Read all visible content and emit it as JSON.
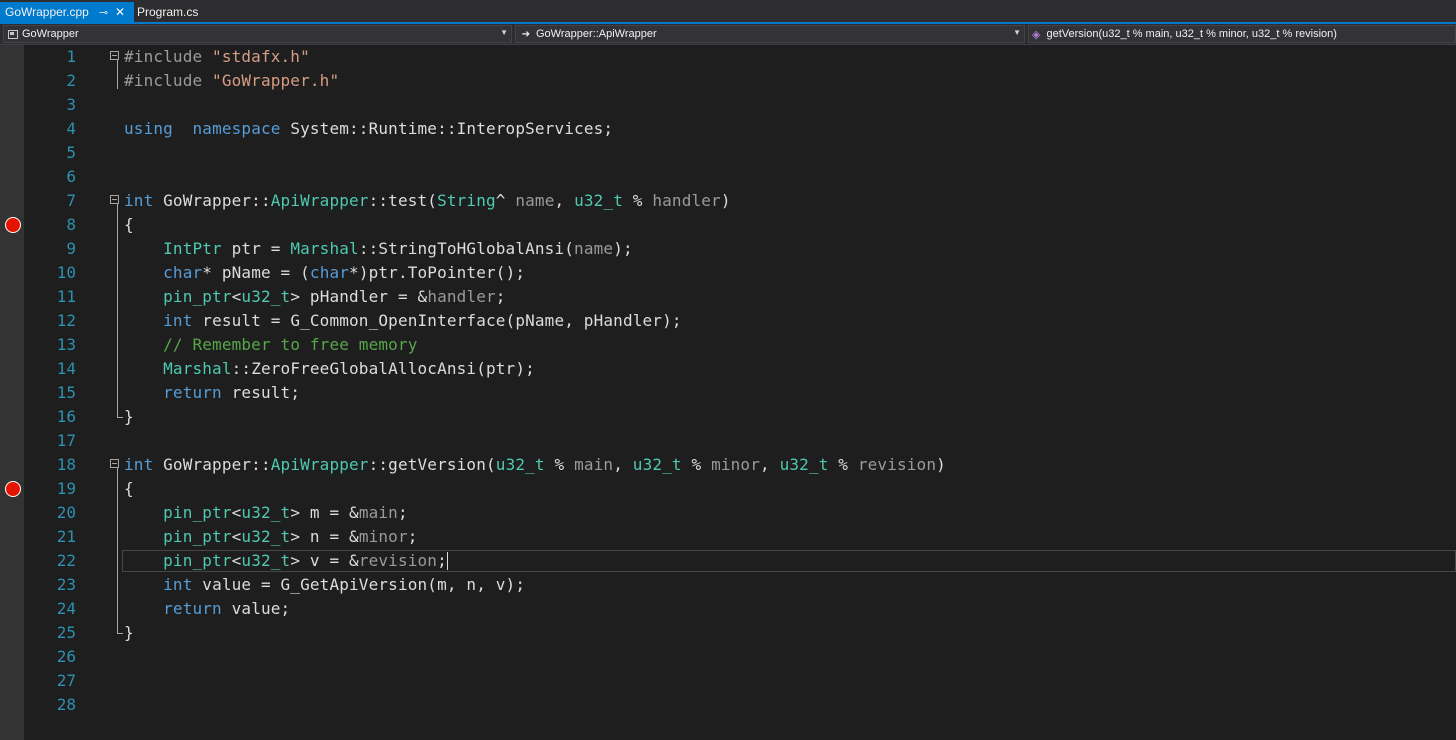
{
  "tabs": [
    {
      "label": "GoWrapper.cpp",
      "active": true
    },
    {
      "label": "Program.cs",
      "active": false
    }
  ],
  "tab_pin_icon": "pin-icon",
  "tab_close_icon": "close-icon",
  "navbar": {
    "project": "GoWrapper",
    "scope": "GoWrapper::ApiWrapper",
    "member": "getVersion(u32_t % main, u32_t % minor, u32_t % revision)"
  },
  "colors": {
    "accent": "#007acc",
    "keyword": "#569cd6",
    "type": "#4ec9b0",
    "string": "#d69d85",
    "comment": "#57a64a",
    "line_number": "#2b91af",
    "breakpoint": "#e51400"
  },
  "editor": {
    "line_numbers": [
      "1",
      "2",
      "3",
      "4",
      "5",
      "6",
      "7",
      "8",
      "9",
      "10",
      "11",
      "12",
      "13",
      "14",
      "15",
      "16",
      "17",
      "18",
      "19",
      "20",
      "21",
      "22",
      "23",
      "24",
      "25",
      "26",
      "27",
      "28"
    ],
    "breakpoint_lines": [
      8,
      19
    ],
    "current_line": 22,
    "lines": [
      [
        [
          "pp",
          "#include "
        ],
        [
          "st",
          "\"stdafx.h\""
        ]
      ],
      [
        [
          "pp",
          "#include "
        ],
        [
          "st",
          "\"GoWrapper.h\""
        ]
      ],
      [],
      [
        [
          "kw",
          "using"
        ],
        [
          "",
          "  "
        ],
        [
          "kw",
          "namespace"
        ],
        [
          "",
          " System::Runtime::InteropServices;"
        ]
      ],
      [],
      [],
      [
        [
          "kw",
          "int"
        ],
        [
          "",
          " GoWrapper::"
        ],
        [
          "ty",
          "ApiWrapper"
        ],
        [
          "",
          "::test("
        ],
        [
          "ty",
          "String"
        ],
        [
          "",
          "^ "
        ],
        [
          "pm",
          "name"
        ],
        [
          "",
          ", "
        ],
        [
          "ty",
          "u32_t"
        ],
        [
          "",
          " % "
        ],
        [
          "pm",
          "handler"
        ],
        [
          "",
          ")"
        ]
      ],
      [
        [
          "",
          "{"
        ]
      ],
      [
        [
          "",
          "    "
        ],
        [
          "ty",
          "IntPtr"
        ],
        [
          "",
          " ptr = "
        ],
        [
          "ty",
          "Marshal"
        ],
        [
          "",
          "::StringToHGlobalAnsi("
        ],
        [
          "pm",
          "name"
        ],
        [
          "",
          ");"
        ]
      ],
      [
        [
          "",
          "    "
        ],
        [
          "kw",
          "char"
        ],
        [
          "",
          "* pName = ("
        ],
        [
          "kw",
          "char"
        ],
        [
          "",
          "*)ptr.ToPointer();"
        ]
      ],
      [
        [
          "",
          "    "
        ],
        [
          "ty",
          "pin_ptr"
        ],
        [
          "",
          "<"
        ],
        [
          "ty",
          "u32_t"
        ],
        [
          "",
          "> pHandler = &"
        ],
        [
          "pm",
          "handler"
        ],
        [
          "",
          ";"
        ]
      ],
      [
        [
          "",
          "    "
        ],
        [
          "kw",
          "int"
        ],
        [
          "",
          " result = G_Common_OpenInterface(pName, pHandler);"
        ]
      ],
      [
        [
          "",
          "    "
        ],
        [
          "cm",
          "// Remember to free memory"
        ]
      ],
      [
        [
          "",
          "    "
        ],
        [
          "ty",
          "Marshal"
        ],
        [
          "",
          "::ZeroFreeGlobalAllocAnsi(ptr);"
        ]
      ],
      [
        [
          "",
          "    "
        ],
        [
          "kw",
          "return"
        ],
        [
          "",
          " result;"
        ]
      ],
      [
        [
          "",
          "}"
        ]
      ],
      [],
      [
        [
          "kw",
          "int"
        ],
        [
          "",
          " GoWrapper::"
        ],
        [
          "ty",
          "ApiWrapper"
        ],
        [
          "",
          "::getVersion("
        ],
        [
          "ty",
          "u32_t"
        ],
        [
          "",
          " % "
        ],
        [
          "pm",
          "main"
        ],
        [
          "",
          ", "
        ],
        [
          "ty",
          "u32_t"
        ],
        [
          "",
          " % "
        ],
        [
          "pm",
          "minor"
        ],
        [
          "",
          ", "
        ],
        [
          "ty",
          "u32_t"
        ],
        [
          "",
          " % "
        ],
        [
          "pm",
          "revision"
        ],
        [
          "",
          ")"
        ]
      ],
      [
        [
          "",
          "{"
        ]
      ],
      [
        [
          "",
          "    "
        ],
        [
          "ty",
          "pin_ptr"
        ],
        [
          "",
          "<"
        ],
        [
          "ty",
          "u32_t"
        ],
        [
          "",
          "> m = &"
        ],
        [
          "pm",
          "main"
        ],
        [
          "",
          ";"
        ]
      ],
      [
        [
          "",
          "    "
        ],
        [
          "ty",
          "pin_ptr"
        ],
        [
          "",
          "<"
        ],
        [
          "ty",
          "u32_t"
        ],
        [
          "",
          "> n = &"
        ],
        [
          "pm",
          "minor"
        ],
        [
          "",
          ";"
        ]
      ],
      [
        [
          "",
          "    "
        ],
        [
          "ty",
          "pin_ptr"
        ],
        [
          "",
          "<"
        ],
        [
          "ty",
          "u32_t"
        ],
        [
          "",
          "> v = &"
        ],
        [
          "pm",
          "revision"
        ],
        [
          "",
          ";"
        ]
      ],
      [
        [
          "",
          "    "
        ],
        [
          "kw",
          "int"
        ],
        [
          "",
          " value = G_GetApiVersion(m, n, v);"
        ]
      ],
      [
        [
          "",
          "    "
        ],
        [
          "kw",
          "return"
        ],
        [
          "",
          " value;"
        ]
      ],
      [
        [
          "",
          "}"
        ]
      ],
      [],
      [],
      []
    ]
  }
}
